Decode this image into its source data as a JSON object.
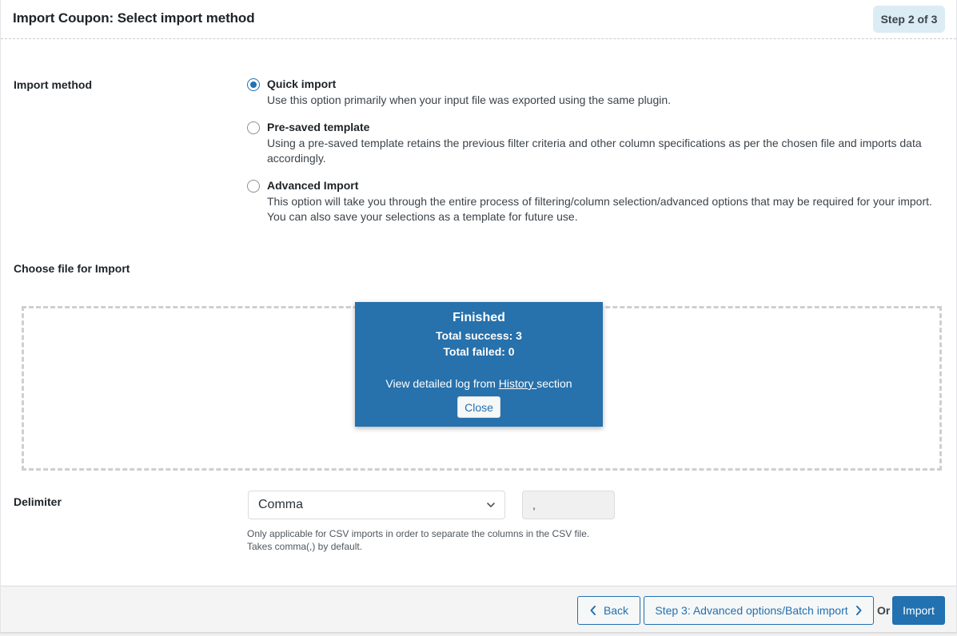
{
  "header": {
    "title": "Import Coupon: Select import method",
    "step_badge": "Step 2 of 3"
  },
  "import_method": {
    "label": "Import method",
    "selected": "quick",
    "options": [
      {
        "id": "quick",
        "title": "Quick import",
        "description": "Use this option primarily when your input file was exported using the same plugin.",
        "checked": true
      },
      {
        "id": "template",
        "title": "Pre-saved template",
        "description": "Using a pre-saved template retains the previous filter criteria and other column specifications as per the chosen file and imports data accordingly.",
        "checked": false
      },
      {
        "id": "advanced",
        "title": "Advanced Import",
        "description": "This option will take you through the entire process of filtering/column selection/advanced options that may be required for your import. You can also save your selections as a template for future use.",
        "checked": false
      }
    ]
  },
  "choose_file": {
    "label": "Choose file for Import"
  },
  "finished_popup": {
    "title": "Finished",
    "total_success": "Total success: 3",
    "total_failed": "Total failed: 0",
    "log_prefix": "View detailed log from ",
    "log_link": "History ",
    "log_suffix": "section",
    "close_label": "Close",
    "background_color": "#2771ac"
  },
  "delimiter": {
    "label": "Delimiter",
    "selected": "Comma",
    "value": ",",
    "help_line1": "Only applicable for CSV imports in order to separate the columns in the CSV file.",
    "help_line2": "Takes comma(,) by default."
  },
  "footer": {
    "back_label": "Back",
    "next_label": "Step 3: Advanced options/Batch import",
    "or_label": "Or",
    "import_label": "Import",
    "accent_color": "#2271b1"
  }
}
